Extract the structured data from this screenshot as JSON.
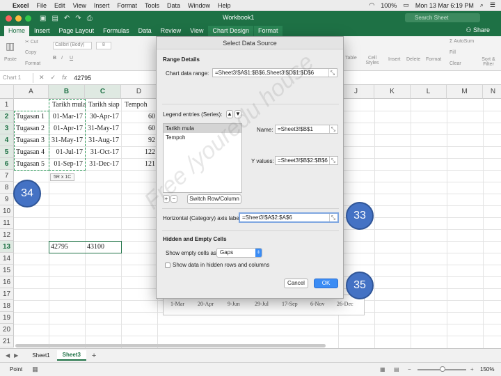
{
  "menubar": {
    "app": "Excel",
    "items": [
      "File",
      "Edit",
      "View",
      "Insert",
      "Format",
      "Tools",
      "Data",
      "Window",
      "Help"
    ],
    "battery": "100%",
    "datetime": "Mon 13 Mar  6:19 PM"
  },
  "window": {
    "title": "Workbook1",
    "search_placeholder": "Search Sheet",
    "share": "Share"
  },
  "ribbon_tabs": [
    "Home",
    "Insert",
    "Page Layout",
    "Formulas",
    "Data",
    "Review",
    "View",
    "Chart Design",
    "Format"
  ],
  "ribbon": {
    "paste": "Paste",
    "cut": "Cut",
    "copy": "Copy",
    "format": "Format",
    "font": "Calibri (Body)",
    "size": "8",
    "autosum": "AutoSum",
    "fill": "Fill",
    "clear": "Clear",
    "sort_filter": "Sort & Filter",
    "table": "Table",
    "cell_styles": "Cell Styles",
    "insert": "Insert",
    "delete": "Delete",
    "format_cells": "Format"
  },
  "formula_bar": {
    "name_box": "Chart 1",
    "fx": "fx",
    "value": "42795"
  },
  "columns": [
    "A",
    "B",
    "C",
    "D",
    "E",
    "F",
    "G",
    "H",
    "I",
    "J",
    "K",
    "L",
    "M",
    "N"
  ],
  "rows": [
    "1",
    "2",
    "3",
    "4",
    "5",
    "6",
    "7",
    "8",
    "9",
    "10",
    "11",
    "12",
    "13",
    "14",
    "15",
    "16",
    "17",
    "18",
    "19",
    "20",
    "21"
  ],
  "headers": {
    "b": "Tarikh mula",
    "c": "Tarikh siap",
    "d": "Tempoh"
  },
  "tasks": [
    {
      "name": "Tugasan 1",
      "start": "01-Mar-17",
      "end": "30-Apr-17",
      "dur": "60"
    },
    {
      "name": "Tugasan 2",
      "start": "01-Apr-17",
      "end": "31-May-17",
      "dur": "60"
    },
    {
      "name": "Tugasan 3",
      "start": "31-May-17",
      "end": "31-Aug-17",
      "dur": "92"
    },
    {
      "name": "Tugasan 4",
      "start": "01-Jul-17",
      "end": "31-Oct-17",
      "dur": "122"
    },
    {
      "name": "Tugasan 5",
      "start": "01-Sep-17",
      "end": "31-Dec-17",
      "dur": "121"
    }
  ],
  "row13": {
    "b": "42795",
    "c": "43100"
  },
  "selection_tooltip": "5R x 1C",
  "badges": {
    "b34": "34",
    "b33": "33",
    "b35": "35"
  },
  "chart_ticks": [
    "1-Mar",
    "20-Apr",
    "9-Jun",
    "29-Jul",
    "17-Sep",
    "6-Nov",
    "26-Dec"
  ],
  "sheets": [
    "Sheet1",
    "Sheet3"
  ],
  "status": {
    "mode": "Point",
    "zoom": "150%"
  },
  "dialog": {
    "title": "Select Data Source",
    "range_details": "Range Details",
    "chart_range_label": "Chart data range:",
    "chart_range_value": "=Sheet3!$A$1:$B$6,Sheet3!$D$1:$D$6",
    "legend_label": "Legend entries (Series):",
    "series": [
      "Tarikh mula",
      "Tempoh"
    ],
    "name_label": "Name:",
    "name_value": "=Sheet3!$B$1",
    "yvalues_label": "Y values:",
    "yvalues_value": "=Sheet3!$B$2:$B$6",
    "switch_btn": "Switch Row/Column",
    "haxis_label": "Horizontal (Category) axis labels:",
    "haxis_value": "=Sheet3!$A$2:$A$6",
    "hidden_section": "Hidden and Empty Cells",
    "empty_cells_label": "Show empty cells as:",
    "empty_cells_value": "Gaps",
    "hidden_rows_label": "Show data in hidden rows and columns",
    "cancel": "Cancel",
    "ok": "OK"
  },
  "watermark": "Free /youredu house",
  "colors": {
    "excel_green": "#1e7145",
    "badge_blue": "#4472c4",
    "ok_blue": "#3b8cf4"
  }
}
